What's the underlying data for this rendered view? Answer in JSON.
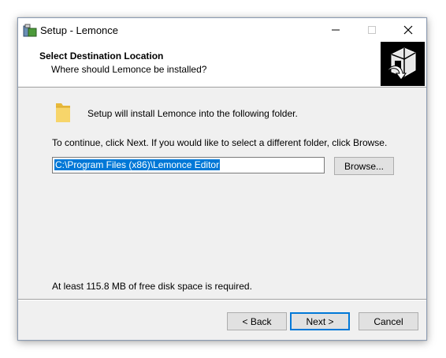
{
  "window": {
    "title": "Setup - Lemonce"
  },
  "header": {
    "title": "Select Destination Location",
    "subtitle": "Where should Lemonce be installed?"
  },
  "body": {
    "intro": "Setup will install Lemonce into the following folder.",
    "continue_text": "To continue, click Next. If you would like to select a different folder, click Browse.",
    "path_value": "C:\\Program Files (x86)\\Lemonce Editor",
    "browse_label": "Browse...",
    "disk_space": "At least 115.8 MB of free disk space is required."
  },
  "footer": {
    "back_label": "< Back",
    "next_label": "Next >",
    "cancel_label": "Cancel"
  },
  "colors": {
    "selection": "#0078d7",
    "dialog_bg": "#f0f0f0"
  },
  "icons": [
    "setup-app-icon",
    "minimize-icon",
    "maximize-icon",
    "close-icon",
    "installer-logo",
    "folder-icon"
  ]
}
